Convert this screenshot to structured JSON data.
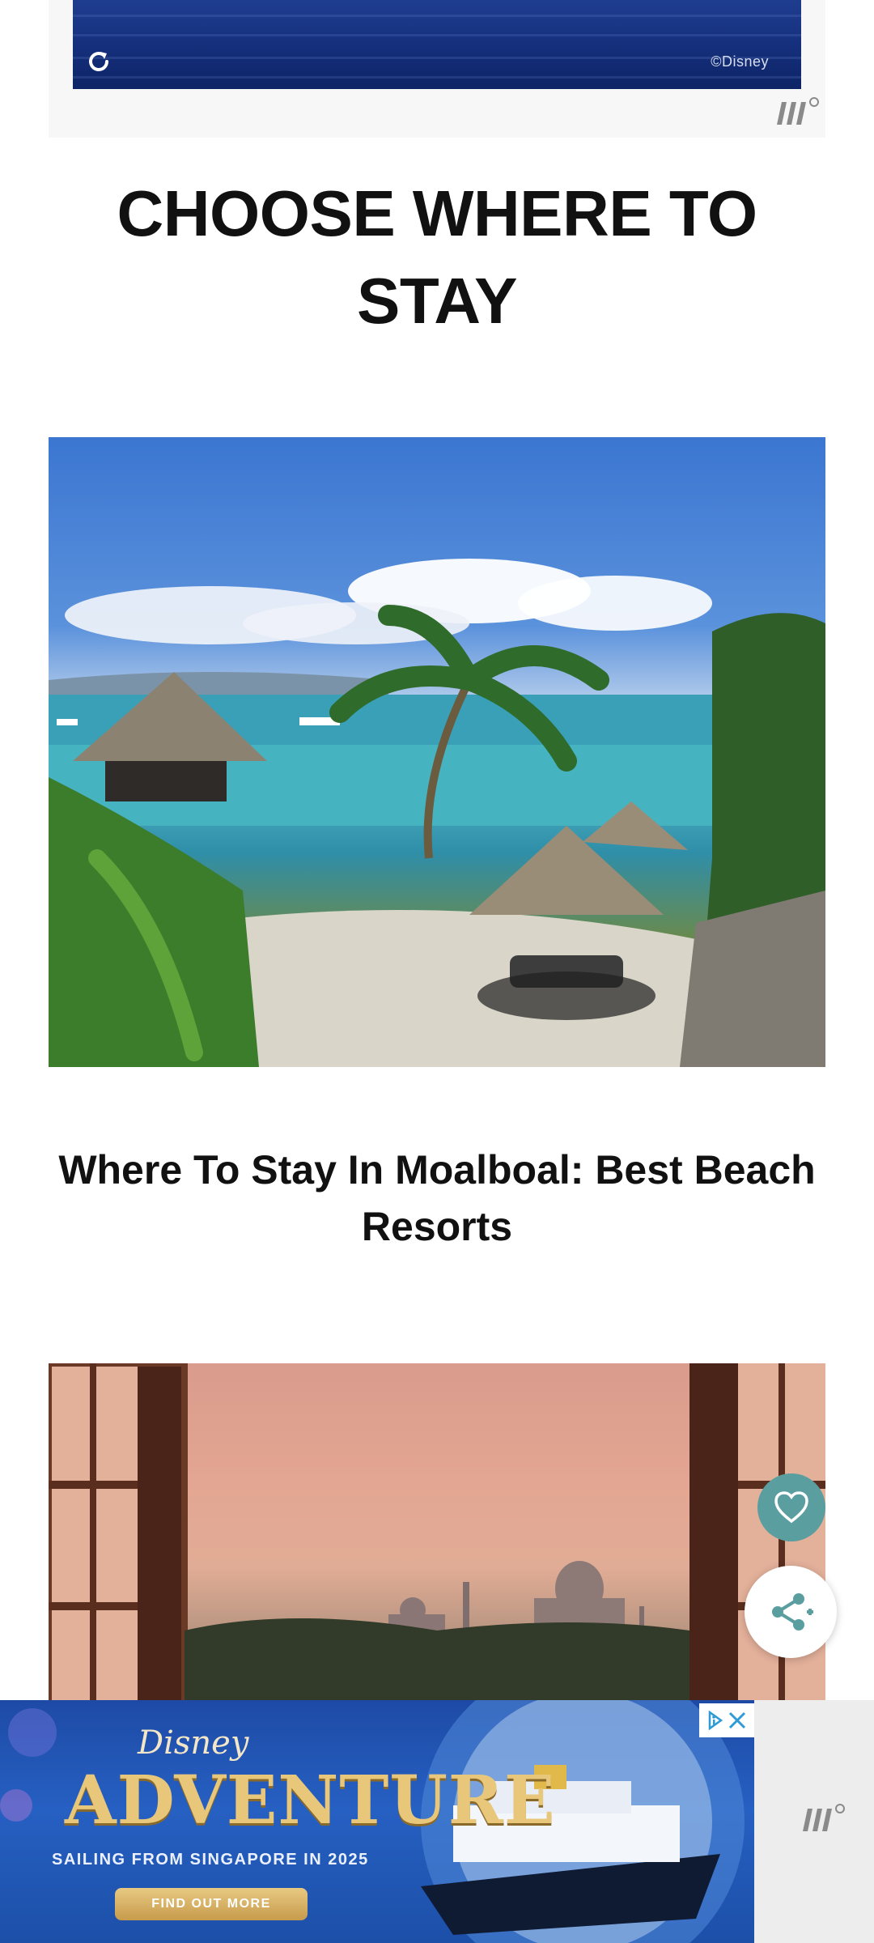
{
  "top_ad": {
    "copyright": "©Disney",
    "replay_icon": "replay-icon",
    "logo_icon": "mediavine-logo-icon"
  },
  "section": {
    "title": "CHOOSE WHERE TO STAY"
  },
  "article": {
    "title": "Where To Stay In Moalboal: Best Beach Resorts"
  },
  "floating": {
    "favorite_icon": "heart-icon",
    "share_icon": "share-icon",
    "favorite_color": "#5a9ea0"
  },
  "bottom_ad": {
    "brand": "Disney",
    "headline": "ADVENTURE",
    "subline": "SAILING FROM SINGAPORE IN 2025",
    "cta": "FIND OUT MORE",
    "close_icons": [
      "adchoices-icon",
      "close-icon"
    ]
  }
}
